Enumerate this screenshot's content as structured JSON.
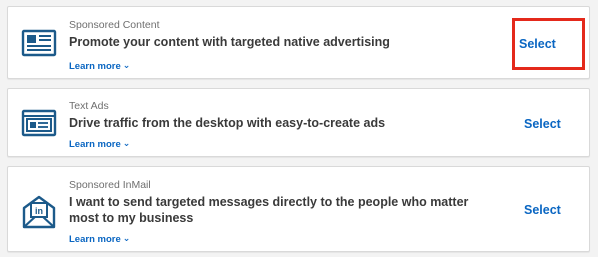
{
  "options": [
    {
      "type": "Sponsored Content",
      "headline": "Promote your content with targeted native advertising",
      "learn_more": "Learn more",
      "select": "Select",
      "icon": "sponsored-content-icon"
    },
    {
      "type": "Text Ads",
      "headline": "Drive traffic from the desktop with easy-to-create ads",
      "learn_more": "Learn more",
      "select": "Select",
      "icon": "text-ads-icon"
    },
    {
      "type": "Sponsored InMail",
      "headline": "I want to send targeted messages directly to the people who matter most to my business",
      "learn_more": "Learn more",
      "select": "Select",
      "icon": "inmail-envelope-icon"
    }
  ],
  "colors": {
    "accent": "#0a66c2",
    "highlight": "#e4291b",
    "icon": "#1c5a8a"
  }
}
